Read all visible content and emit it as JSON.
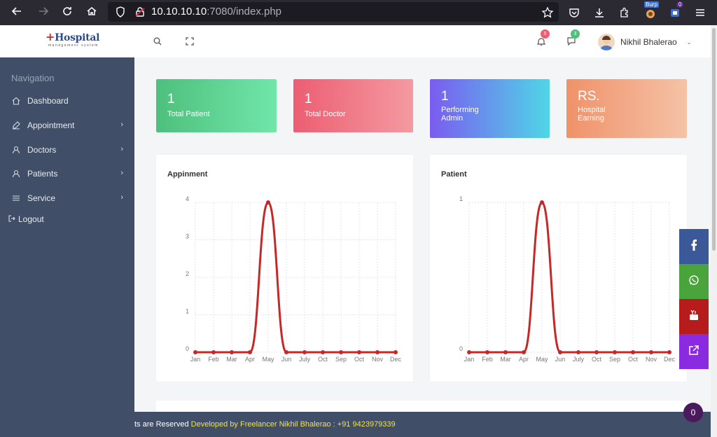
{
  "browser": {
    "url_host": "10.10.10.10",
    "url_path": ":7080/index.php",
    "burp_label": "Burp",
    "ext_badge": "0"
  },
  "header": {
    "logo_title": "Hospital",
    "logo_subtitle": "management system",
    "notif_count": "5",
    "msg_count": "3",
    "user_name": "Nikhil Bhalerao"
  },
  "sidebar": {
    "title": "Navigation",
    "items": [
      {
        "label": "Dashboard",
        "icon": "home-icon",
        "has_children": false
      },
      {
        "label": "Appointment",
        "icon": "edit-icon",
        "has_children": true
      },
      {
        "label": "Doctors",
        "icon": "user-icon",
        "has_children": true
      },
      {
        "label": "Patients",
        "icon": "user-icon",
        "has_children": true
      },
      {
        "label": "Service",
        "icon": "menu-icon",
        "has_children": true
      }
    ],
    "logout_label": "Logout"
  },
  "cards": [
    {
      "value": "1",
      "label": "Total Patient",
      "colors": [
        "#4ec07d",
        "#70e6a9"
      ]
    },
    {
      "value": "1",
      "label": "Total Doctor",
      "colors": [
        "#ec5e72",
        "#f49aa1"
      ]
    },
    {
      "value": "1",
      "label_line1": "Performing",
      "label_line2": "Admin",
      "colors": [
        "#7a5cf0",
        "#4fd6e6"
      ]
    },
    {
      "value": "RS.",
      "label_line1": "Hospital",
      "label_line2": "Earning",
      "colors": [
        "#f0926a",
        "#f5c2a6"
      ]
    }
  ],
  "chart_data": [
    {
      "type": "line",
      "title": "Appinment",
      "categories": [
        "Jan",
        "Feb",
        "Mar",
        "Apr",
        "May",
        "Jun",
        "July",
        "Oct",
        "Sep",
        "Oct",
        "Nov",
        "Dec"
      ],
      "values": [
        0,
        0,
        0,
        0,
        4,
        0,
        0,
        0,
        0,
        0,
        0,
        0
      ],
      "yticks": [
        "0",
        "1",
        "2",
        "3",
        "4"
      ],
      "ylim": [
        0,
        4
      ],
      "color": "#c62828",
      "grid": true
    },
    {
      "type": "line",
      "title": "Patient",
      "categories": [
        "Jan",
        "Feb",
        "Mar",
        "Apr",
        "May",
        "Jun",
        "July",
        "Oct",
        "Sep",
        "Oct",
        "Nov",
        "Dec"
      ],
      "values": [
        0,
        0,
        0,
        0,
        1,
        0,
        0,
        0,
        0,
        0,
        0,
        0
      ],
      "yticks": [
        "0",
        "1"
      ],
      "ylim": [
        0,
        1
      ],
      "color": "#c62828",
      "grid": true
    }
  ],
  "social": [
    {
      "icon": "facebook-icon",
      "color": "#3b5998"
    },
    {
      "icon": "whatsapp-icon",
      "color": "#4aa43c"
    },
    {
      "icon": "youtube-icon",
      "color": "#b71c1c"
    },
    {
      "icon": "external-link-icon",
      "color": "#8a2be2"
    }
  ],
  "footer": {
    "text": "ts are Reserved",
    "dev_text": "Developed by Freelancer Nikhil Bhalerao : +91 9423979339"
  },
  "counter": "0"
}
